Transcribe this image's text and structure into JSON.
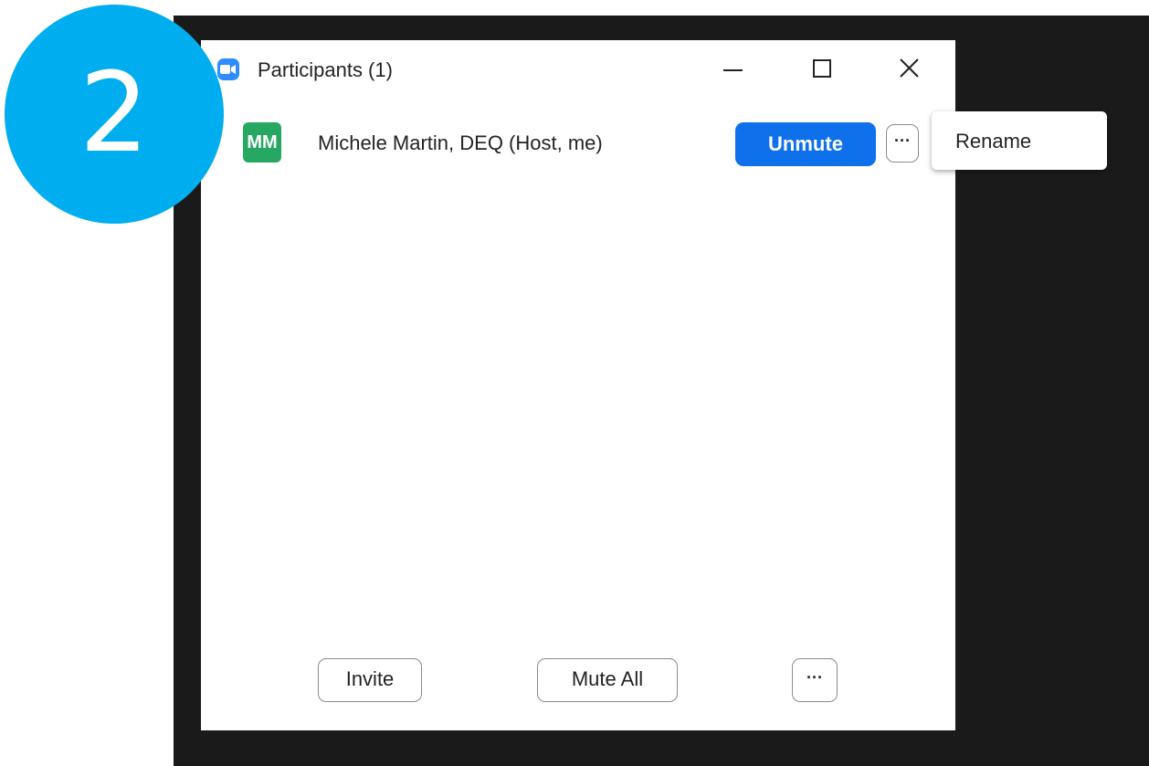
{
  "step_badge": {
    "number": "2",
    "color": "#00aeef"
  },
  "window": {
    "title": "Participants (1)",
    "app_icon": "zoom-camera-icon",
    "controls": [
      "minimize-icon",
      "maximize-icon",
      "close-icon"
    ]
  },
  "participant": {
    "initials": "MM",
    "avatar_color": "#27a862",
    "name": "Michele Martin, DEQ (Host, me)",
    "unmute_label": "Unmute",
    "more_label": "···"
  },
  "context_menu": {
    "items": [
      {
        "label": "Rename"
      }
    ]
  },
  "footer": {
    "invite_label": "Invite",
    "mute_all_label": "Mute All",
    "more_label": "···"
  },
  "colors": {
    "accent": "#0e71eb",
    "backdrop": "#1a1a1a"
  }
}
